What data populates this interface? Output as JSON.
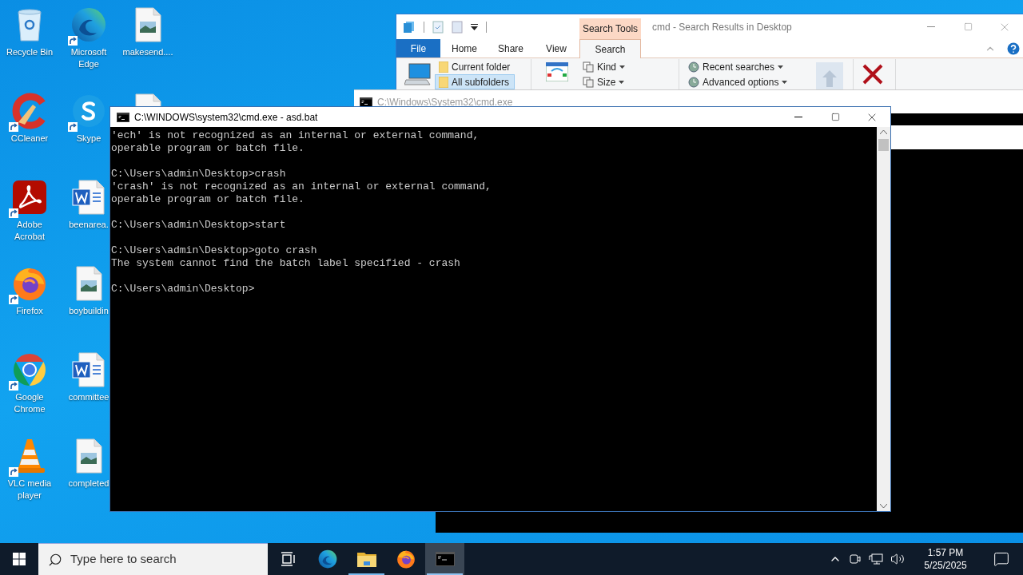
{
  "desktop": {
    "icons": [
      {
        "label": "Recycle Bin",
        "kind": "recycle"
      },
      {
        "label": "CCleaner",
        "kind": "ccleaner",
        "shortcut": true
      },
      {
        "label": "Adobe Acrobat",
        "kind": "acrobat",
        "shortcut": true
      },
      {
        "label": "Firefox",
        "kind": "firefox",
        "shortcut": true
      },
      {
        "label": "Google Chrome",
        "kind": "chrome",
        "shortcut": true
      },
      {
        "label": "VLC media player",
        "kind": "vlc",
        "shortcut": true
      },
      {
        "label": "Microsoft Edge",
        "kind": "edge",
        "shortcut": true
      },
      {
        "label": "Skype",
        "kind": "skype",
        "shortcut": true
      },
      {
        "label": "beenarea.",
        "kind": "word"
      },
      {
        "label": "boybuildin",
        "kind": "image"
      },
      {
        "label": "committee",
        "kind": "word"
      },
      {
        "label": "completed",
        "kind": "image"
      },
      {
        "label": "makesend....",
        "kind": "image"
      },
      {
        "kind": "image"
      }
    ]
  },
  "explorer_window": {
    "title": "cmd - Search Results in Desktop",
    "contextual_tab": "Search Tools",
    "tabs": [
      {
        "label": "File",
        "kind": "file",
        "selected": false
      },
      {
        "label": "Home",
        "kind": "tab",
        "selected": false
      },
      {
        "label": "Share",
        "kind": "tab",
        "selected": false
      },
      {
        "label": "View",
        "kind": "tab",
        "selected": false
      },
      {
        "label": "Search",
        "kind": "tab",
        "selected": true
      }
    ],
    "location_options": [
      {
        "label": "Current folder",
        "selected": false
      },
      {
        "label": "All subfolders",
        "selected": true
      }
    ],
    "refine": [
      "Kind",
      "Size"
    ],
    "options": [
      "Recent searches",
      "Advanced options"
    ]
  },
  "background_console": {
    "title": "C:\\Windows\\System32\\cmd.exe"
  },
  "console": {
    "title": "C:\\WINDOWS\\system32\\cmd.exe - asd.bat",
    "blocks": [
      [
        "'ech' is not recognized as an internal or external command,",
        "operable program or batch file."
      ],
      [
        "C:\\Users\\admin\\Desktop>crash",
        "'crash' is not recognized as an internal or external command,",
        "operable program or batch file."
      ],
      [
        "C:\\Users\\admin\\Desktop>start"
      ],
      [
        "C:\\Users\\admin\\Desktop>goto crash",
        "The system cannot find the batch label specified - crash"
      ],
      [
        "C:\\Users\\admin\\Desktop>"
      ]
    ]
  },
  "taskbar": {
    "search_placeholder": "Type here to search",
    "apps": [
      {
        "kind": "taskview",
        "running": false,
        "selected": false
      },
      {
        "kind": "edge",
        "running": false,
        "selected": false
      },
      {
        "kind": "folder",
        "running": true,
        "selected": false
      },
      {
        "kind": "firefox",
        "running": false,
        "selected": false
      },
      {
        "kind": "console",
        "running": true,
        "selected": true
      }
    ],
    "time": "1:57 PM",
    "date": "5/25/2025"
  }
}
